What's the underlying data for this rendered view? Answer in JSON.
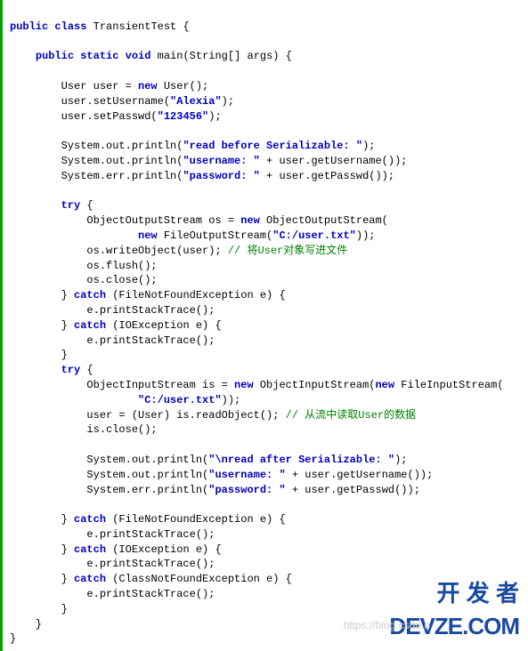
{
  "code": {
    "l1_kw1": "public",
    "l1_kw2": "class",
    "l1_name": " TransientTest {",
    "l2": "",
    "l3_kw1": "public",
    "l3_kw2": "static",
    "l3_kw3": "void",
    "l3_rest": " main(String[] args) {",
    "l4": "",
    "l5_a": "        User user = ",
    "l5_kw": "new",
    "l5_b": " User();",
    "l6_a": "        user.setUsername(",
    "l6_str": "\"Alexia\"",
    "l6_b": ");",
    "l7_a": "        user.setPasswd(",
    "l7_str": "\"123456\"",
    "l7_b": ");",
    "l8": "",
    "l9_a": "        System.out.println(",
    "l9_str": "\"read before Serializable: \"",
    "l9_b": ");",
    "l10_a": "        System.out.println(",
    "l10_str": "\"username: \"",
    "l10_b": " + user.getUsername());",
    "l11_a": "        System.err.println(",
    "l11_str": "\"password: \"",
    "l11_b": " + user.getPasswd());",
    "l12": "",
    "l13_a": "        ",
    "l13_kw": "try",
    "l13_b": " {",
    "l14_a": "            ObjectOutputStream os = ",
    "l14_kw": "new",
    "l14_b": " ObjectOutputStream(",
    "l15_a": "                    ",
    "l15_kw": "new",
    "l15_b": " FileOutputStream(",
    "l15_str": "\"C:/user.txt\"",
    "l15_c": "));",
    "l16_a": "            os.writeObject(user); ",
    "l16_comment": "// 将User对象写进文件",
    "l17": "            os.flush();",
    "l18": "            os.close();",
    "l19_a": "        } ",
    "l19_kw": "catch",
    "l19_b": " (FileNotFoundException e) {",
    "l20": "            e.printStackTrace();",
    "l21_a": "        } ",
    "l21_kw": "catch",
    "l21_b": " (IOException e) {",
    "l22": "            e.printStackTrace();",
    "l23": "        }",
    "l24_a": "        ",
    "l24_kw": "try",
    "l24_b": " {",
    "l25_a": "            ObjectInputStream is = ",
    "l25_kw1": "new",
    "l25_b": " ObjectInputStream(",
    "l25_kw2": "new",
    "l25_c": " FileInputStream(",
    "l26_a": "                    ",
    "l26_str": "\"C:/user.txt\"",
    "l26_b": "));",
    "l27_a": "            user = (User) is.readObject(); ",
    "l27_comment": "// 从流中读取User的数据",
    "l28": "            is.close();",
    "l29": "",
    "l30_a": "            System.out.println(",
    "l30_str": "\"\\nread after Serializable: \"",
    "l30_b": ");",
    "l31_a": "            System.out.println(",
    "l31_str": "\"username: \"",
    "l31_b": " + user.getUsername());",
    "l32_a": "            System.err.println(",
    "l32_str": "\"password: \"",
    "l32_b": " + user.getPasswd());",
    "l33": "",
    "l34_a": "        } ",
    "l34_kw": "catch",
    "l34_b": " (FileNotFoundException e) {",
    "l35": "            e.printStackTrace();",
    "l36_a": "        } ",
    "l36_kw": "catch",
    "l36_b": " (IOException e) {",
    "l37": "            e.printStackTrace();",
    "l38_a": "        } ",
    "l38_kw": "catch",
    "l38_b": " (ClassNotFoundException e) {",
    "l39": "            e.printStackTrace();",
    "l40": "        }",
    "l41": "    }",
    "l42": "}"
  },
  "watermark": {
    "line1": "https://blog.csdn.n",
    "zh": "开 发 者",
    "en": "DEVZE.COM"
  }
}
